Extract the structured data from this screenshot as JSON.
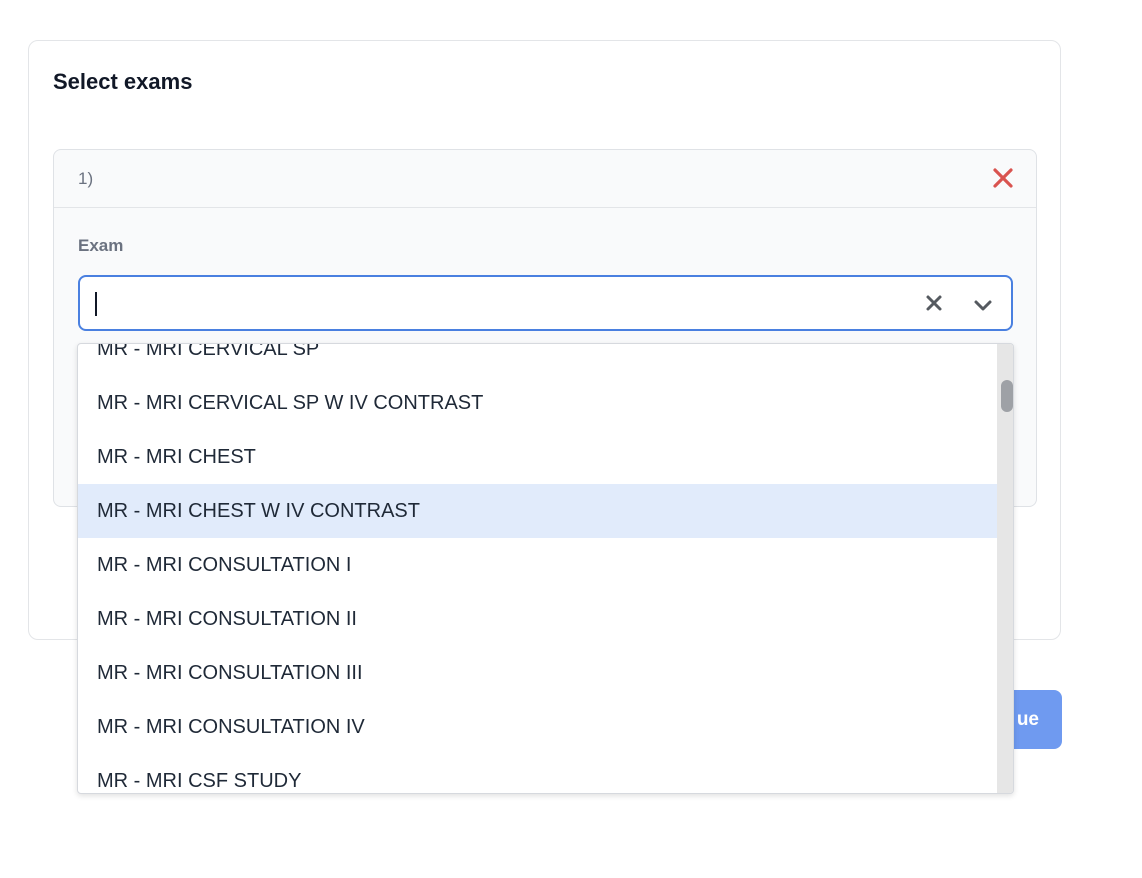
{
  "card": {
    "title": "Select exams"
  },
  "exam_block": {
    "index_label": "1)",
    "field_label": "Exam",
    "input_value": "",
    "remove_icon": "close-x-icon"
  },
  "select": {
    "clear_icon": "clear-x-icon",
    "toggle_icon": "chevron-down-icon"
  },
  "dropdown": {
    "options": [
      "MR - MRI CERVICAL SP",
      "MR - MRI CERVICAL SP W IV CONTRAST",
      "MR - MRI CHEST",
      "MR - MRI CHEST W IV CONTRAST",
      "MR - MRI CONSULTATION I",
      "MR - MRI CONSULTATION II",
      "MR - MRI CONSULTATION III",
      "MR - MRI CONSULTATION IV",
      "MR - MRI CSF STUDY"
    ],
    "highlighted_index": 3
  },
  "continue_button": {
    "label_visible": "ue"
  },
  "colors": {
    "accent_blue": "#4a80e0",
    "highlight_bg": "#e1ebfb",
    "remove_red": "#d9534f",
    "continue_bg": "#6f9af0"
  }
}
